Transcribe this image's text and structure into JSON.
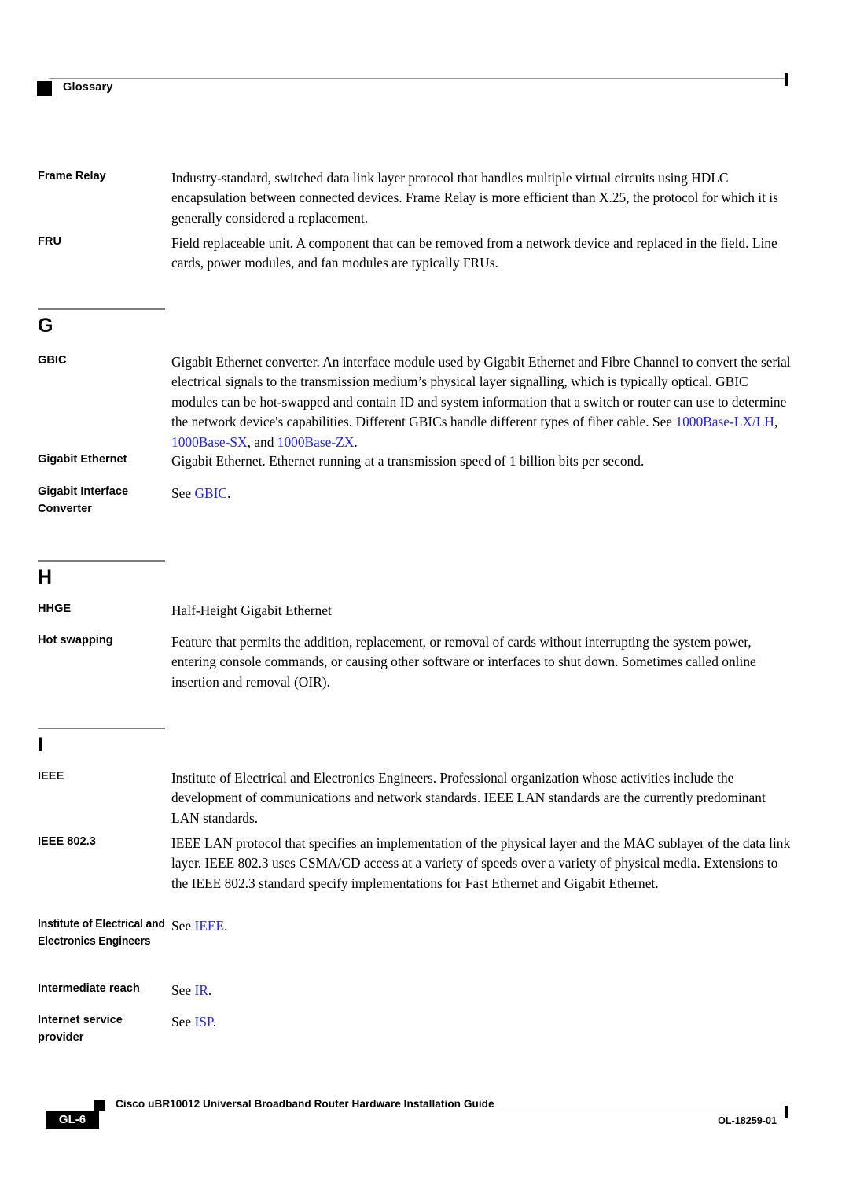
{
  "header": {
    "title": "Glossary"
  },
  "entries": [
    {
      "term": "Frame Relay",
      "definition": "Industry-standard, switched data link layer protocol that handles multiple virtual circuits using HDLC encapsulation between connected devices. Frame Relay is more efficient than X.25, the protocol for which it is generally considered a replacement."
    },
    {
      "term": "FRU",
      "definition": "Field replaceable unit. A component that can be removed from a network device and replaced in the field. Line cards, power modules, and fan modules are typically FRUs."
    },
    {
      "term": "GBIC",
      "definition_prefix": "Gigabit Ethernet converter. An interface module used by Gigabit Ethernet and Fibre Channel to convert the serial electrical signals to the transmission medium’s physical layer signalling, which is typically optical. GBIC modules can be hot-swapped and contain ID and system information that a switch or router can use to determine the network device's capabilities. Different GBICs handle different types of fiber cable. See ",
      "xref1": "1000Base-LX/LH",
      "sep1": ", ",
      "xref2": "1000Base-SX",
      "sep2": ", and ",
      "xref3": "1000Base-ZX",
      "definition_suffix": "."
    },
    {
      "term": "Gigabit Ethernet",
      "definition": "Gigabit Ethernet. Ethernet running at a transmission speed of 1 billion bits per second."
    },
    {
      "term": "Gigabit Interface Converter",
      "see_label": "See ",
      "xref": "GBIC",
      "period": "."
    },
    {
      "term": "HHGE",
      "definition": "Half-Height Gigabit Ethernet"
    },
    {
      "term": "Hot swapping",
      "definition": "Feature that permits the addition, replacement, or removal of cards without interrupting the system power, entering console commands, or causing other software or interfaces to shut down. Sometimes called online insertion and removal (OIR)."
    },
    {
      "term": "IEEE",
      "definition": "Institute of Electrical and Electronics Engineers. Professional organization whose activities include the development of communications and network standards. IEEE LAN standards are the currently predominant LAN standards."
    },
    {
      "term": "IEEE 802.3",
      "definition": "IEEE LAN protocol that specifies an implementation of the physical layer and the MAC sublayer of the data link layer. IEEE 802.3 uses CSMA/CD access at a variety of speeds over a variety of physical media. Extensions to the IEEE 802.3 standard specify implementations for Fast Ethernet and Gigabit Ethernet."
    },
    {
      "term": "Institute of Electrical and Electronics Engineers",
      "see_label": "See ",
      "xref": "IEEE",
      "period": "."
    },
    {
      "term": "Intermediate reach",
      "see_label": "See ",
      "xref": "IR",
      "period": "."
    },
    {
      "term": "Internet service provider",
      "see_label": "See ",
      "xref": "ISP",
      "period": "."
    }
  ],
  "sections": [
    {
      "letter": "G"
    },
    {
      "letter": "H"
    },
    {
      "letter": "I"
    }
  ],
  "footer": {
    "page_number": "GL-6",
    "document_title": "Cisco uBR10012 Universal Broadband Router Hardware Installation Guide",
    "document_id": "OL-18259-01"
  },
  "colors": {
    "xref_blue": "#2222ee",
    "rule_gray": "#949494",
    "text_black": "#000000"
  }
}
